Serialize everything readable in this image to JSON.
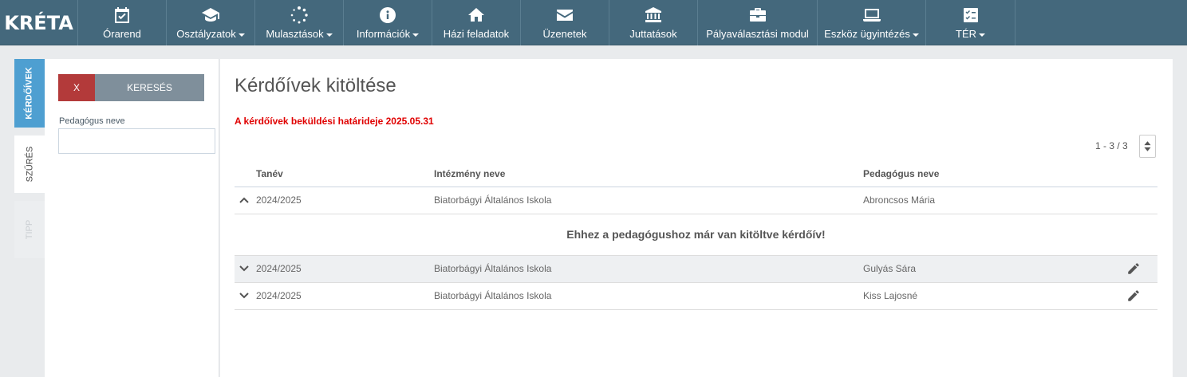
{
  "app": {
    "logo_text": "KRÉTA"
  },
  "nav": [
    {
      "label": "Órarend",
      "icon": "calendar-check-icon",
      "dropdown": false
    },
    {
      "label": "Osztályzatok",
      "icon": "graduation-cap-icon",
      "dropdown": true
    },
    {
      "label": "Mulasztások",
      "icon": "spinner-dots-icon",
      "dropdown": true
    },
    {
      "label": "Információk",
      "icon": "info-circle-icon",
      "dropdown": true
    },
    {
      "label": "Házi feladatok",
      "icon": "home-icon",
      "dropdown": false
    },
    {
      "label": "Üzenetek",
      "icon": "envelope-icon",
      "dropdown": false
    },
    {
      "label": "Juttatások",
      "icon": "bank-icon",
      "dropdown": false
    },
    {
      "label": "Pályaválasztási modul",
      "icon": "briefcase-icon",
      "dropdown": false
    },
    {
      "label": "Eszköz ügyintézés",
      "icon": "laptop-icon",
      "dropdown": true
    },
    {
      "label": "TÉR",
      "icon": "checklist-icon",
      "dropdown": true
    }
  ],
  "side_tabs": {
    "kerdoivek": "KÉRDŐÍVEK",
    "szures": "SZŰRÉS",
    "tipp": "TIPP"
  },
  "filter": {
    "clear_label": "X",
    "search_label": "KERESÉS",
    "teacher_label": "Pedagógus neve",
    "teacher_value": ""
  },
  "main": {
    "title": "Kérdőívek kitöltése",
    "deadline_notice": "A kérdőívek beküldési határideje 2025.05.31",
    "pager": "1 - 3 / 3"
  },
  "table": {
    "columns": {
      "tanev": "Tanév",
      "intezmeny": "Intézmény neve",
      "pedagogus": "Pedagógus neve"
    },
    "rows": [
      {
        "tanev": "2024/2025",
        "intezmeny": "Biatorbágyi Általános Iskola",
        "pedagogus": "Abroncsos Mária",
        "expanded": true,
        "editable": false
      },
      {
        "tanev": "2024/2025",
        "intezmeny": "Biatorbágyi Általános Iskola",
        "pedagogus": "Gulyás Sára",
        "expanded": false,
        "editable": true
      },
      {
        "tanev": "2024/2025",
        "intezmeny": "Biatorbágyi Általános Iskola",
        "pedagogus": "Kiss Lajosné",
        "expanded": false,
        "editable": true
      }
    ],
    "expanded_message": "Ehhez a pedagógushoz már van kitöltve kérdőív!"
  },
  "colors": {
    "navbar": "#44687c",
    "active_tab": "#4e9fd1",
    "clear_button": "#b33a3a",
    "search_button": "#7f8f9b",
    "deadline": "#e00000"
  }
}
